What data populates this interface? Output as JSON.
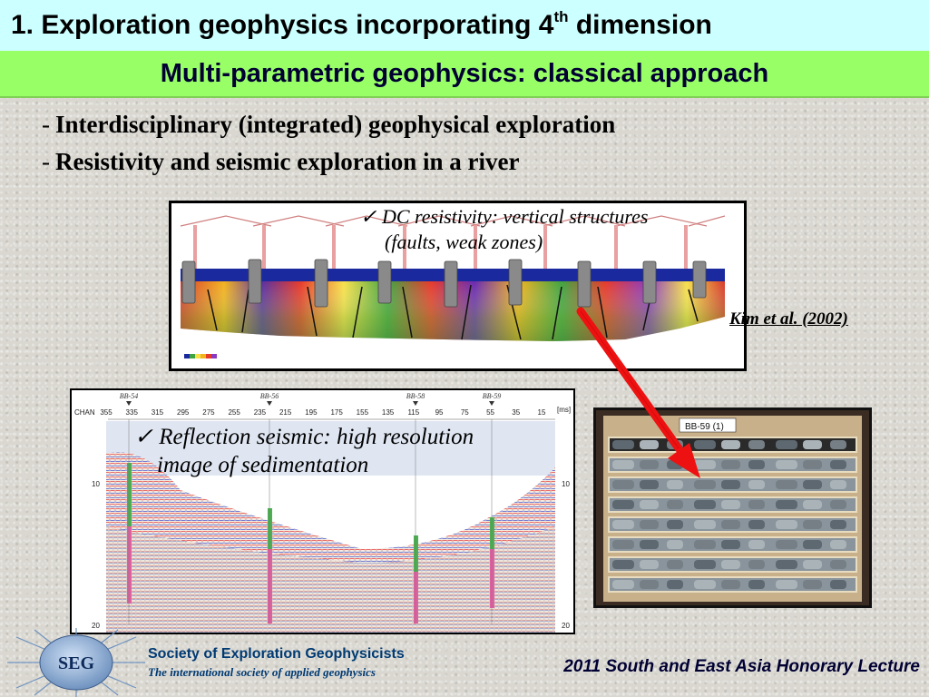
{
  "header": {
    "title_main": "1. Exploration geophysics incorporating 4",
    "title_sup": "th",
    "title_end": " dimension",
    "subtitle": "Multi-parametric geophysics: classical approach"
  },
  "bullets": [
    {
      "dash": "-",
      "text": "Interdisciplinary (integrated) geophysical exploration"
    },
    {
      "dash": "-",
      "text": "Resistivity and seismic exploration in a river"
    }
  ],
  "resistivity_panel": {
    "note_line1": "DC resistivity: vertical structures",
    "note_line2": "(faults, weak zones)",
    "citation": "Kim et al. (2002)"
  },
  "seismic_panel": {
    "note_line1": "Reflection seismic: high resolution",
    "note_line2": "image of sedimentation",
    "chan_label": "CHAN",
    "channels": [
      "355",
      "335",
      "315",
      "295",
      "275",
      "255",
      "235",
      "215",
      "195",
      "175",
      "155",
      "135",
      "115",
      "95",
      "75",
      "55",
      "35",
      "15"
    ],
    "unit": "[ms]",
    "depth_10": "10",
    "depth_20": "20",
    "boreholes": [
      "BB-54",
      "BB-56",
      "BB-58",
      "BB-59"
    ]
  },
  "core_photo": {
    "label": "BB-59 (1)"
  },
  "footer": {
    "org_name": "Society of Exploration Geophysicists",
    "org_tagline": "The international society of applied geophysics",
    "logo_text": "SEG",
    "lecture": "2011 South and East Asia Honorary Lecture"
  },
  "colors": {
    "title_bg": "#ccffff",
    "subtitle_bg": "#99ff66",
    "arrow": "#ee1111",
    "org_blue": "#003a73"
  }
}
